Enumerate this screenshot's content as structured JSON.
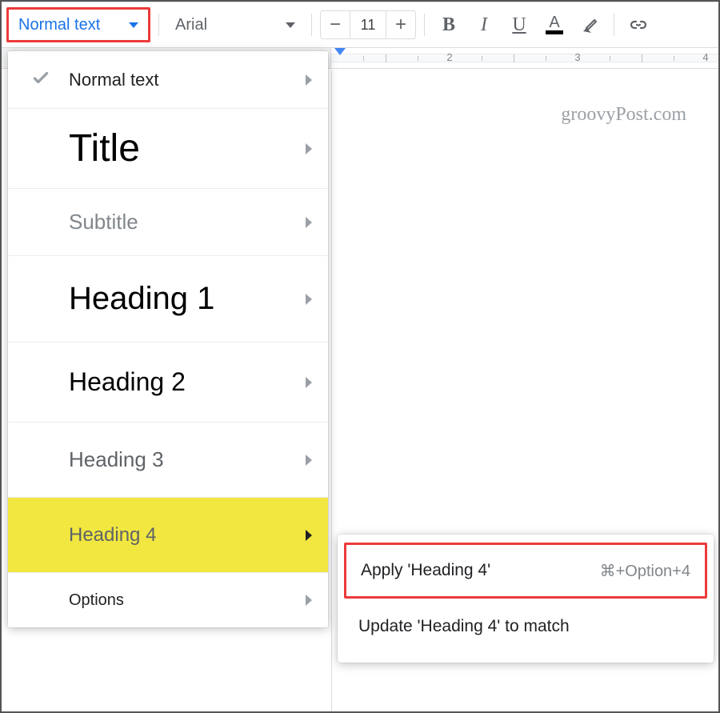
{
  "toolbar": {
    "styles_label": "Normal text",
    "font_label": "Arial",
    "font_size": "11",
    "bold": "B",
    "italic": "I",
    "underline": "U",
    "textcolor_letter": "A"
  },
  "ruler": {
    "numbers": [
      "2",
      "3",
      "4"
    ]
  },
  "watermark": "groovyPost.com",
  "styles_menu": {
    "items": [
      {
        "label": "Normal text",
        "checked": true
      },
      {
        "label": "Title"
      },
      {
        "label": "Subtitle"
      },
      {
        "label": "Heading 1"
      },
      {
        "label": "Heading 2"
      },
      {
        "label": "Heading 3"
      },
      {
        "label": "Heading 4",
        "highlighted": true
      },
      {
        "label": "Options"
      }
    ]
  },
  "submenu": {
    "apply_label": "Apply 'Heading 4'",
    "apply_shortcut": "⌘+Option+4",
    "update_label": "Update 'Heading 4' to match"
  }
}
